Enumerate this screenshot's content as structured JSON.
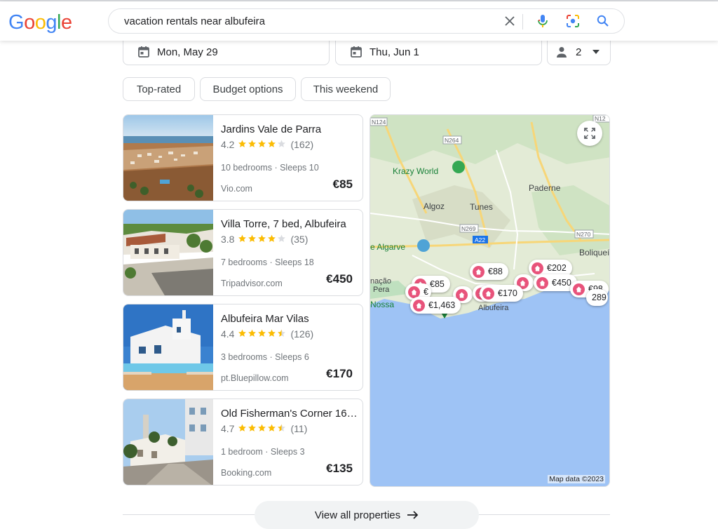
{
  "search": {
    "query": "vacation rentals near albufeira"
  },
  "logo": {
    "letters": [
      "G",
      "o",
      "o",
      "g",
      "l",
      "e"
    ],
    "colors": [
      "#4285F4",
      "#EA4335",
      "#FBBC05",
      "#4285F4",
      "#34A853",
      "#EA4335"
    ]
  },
  "dates": {
    "checkin": "Mon, May 29",
    "checkout": "Thu, Jun 1",
    "guests": "2"
  },
  "chips": [
    "Top-rated",
    "Budget options",
    "This weekend"
  ],
  "listings": [
    {
      "title": "Jardins Vale de Parra",
      "rating": "4.2",
      "stars": 4.2,
      "reviews": "(162)",
      "bedrooms": "10 bedrooms",
      "sleeps": "Sleeps 10",
      "source": "Vio.com",
      "price": "€85"
    },
    {
      "title": "Villa Torre, 7 bed, Albufeira",
      "rating": "3.8",
      "stars": 3.8,
      "reviews": "(35)",
      "bedrooms": "7 bedrooms",
      "sleeps": "Sleeps 18",
      "source": "Tripadvisor.com",
      "price": "€450"
    },
    {
      "title": "Albufeira Mar Vilas",
      "rating": "4.4",
      "stars": 4.4,
      "reviews": "(126)",
      "bedrooms": "3 bedrooms",
      "sleeps": "Sleeps 6",
      "source": "pt.Bluepillow.com",
      "price": "€170"
    },
    {
      "title": "Old Fisherman's Corner 16 ...",
      "rating": "4.7",
      "stars": 4.7,
      "reviews": "(11)",
      "bedrooms": "1 bedroom",
      "sleeps": "Sleeps 3",
      "source": "Booking.com",
      "price": "€135"
    }
  ],
  "map": {
    "places": [
      "Krazy World",
      "Paderne",
      "Algoz",
      "Tunes",
      "e Algarve",
      "Boliqueí",
      "nação",
      "Pera",
      "Nossa",
      "Albufeira"
    ],
    "roads": [
      "N124",
      "N264",
      "N269",
      "A22",
      "N270",
      "N12"
    ],
    "pins": [
      "€85",
      "€88",
      "€202",
      "€450",
      "€98",
      "€170",
      "€1,463",
      "€",
      "289"
    ],
    "attribution": "Map data ©2023"
  },
  "footer": {
    "view_all": "View all properties"
  },
  "colors": {
    "accent": "#1a73e8",
    "pin": "#e8537b",
    "star": "#fbbc04",
    "water": "#9ec3f5"
  }
}
